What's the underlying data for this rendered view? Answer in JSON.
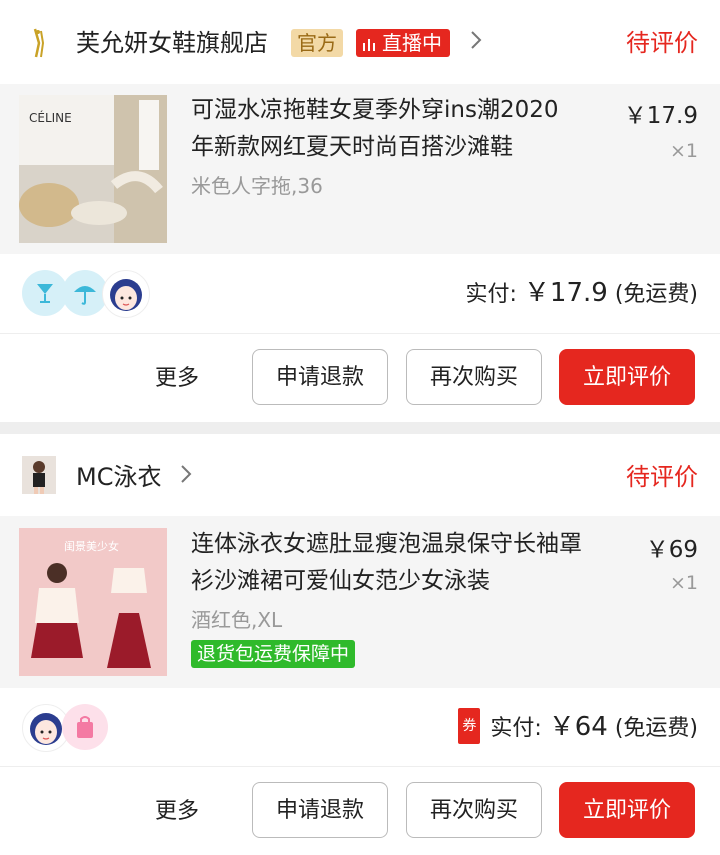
{
  "orders": [
    {
      "shop_name": "芙允妍女鞋旗舰店",
      "badge_official": "官方",
      "badge_live": "直播中",
      "status": "待评价",
      "product_name_line1": "可湿水凉拖鞋女夏季外穿ins潮2020",
      "product_name_line2": "年新款网红夏天时尚百搭沙滩鞋",
      "sku": "米色人字拖,36",
      "price": "￥17.9",
      "qty": "×1",
      "thumb_brand": "CÉLINE",
      "pay_label": "实付:",
      "pay_amount": "￥17.9",
      "pay_note": "(免运费)",
      "more": "更多",
      "btn_refund": "申请退款",
      "btn_rebuy": "再次购买",
      "btn_review": "立即评价"
    },
    {
      "shop_name": "MC泳衣",
      "status": "待评价",
      "product_name_line1": "连体泳衣女遮肚显瘦泡温泉保守长袖罩",
      "product_name_line2": "衫沙滩裙可爱仙女范少女泳装",
      "sku": "酒红色,XL",
      "guarantee": "退货包运费保障中",
      "price": "￥69",
      "qty": "×1",
      "thumb_caption": "闺景美少女",
      "coupon": "券",
      "pay_label": "实付:",
      "pay_amount": "￥64",
      "pay_note": "(免运费)",
      "more": "更多",
      "btn_refund": "申请退款",
      "btn_rebuy": "再次购买",
      "btn_review": "立即评价"
    }
  ],
  "colors": {
    "accent": "#e5271f",
    "guarantee": "#2fba2b",
    "official_bg": "#f3d9a6"
  },
  "icons": [
    "shop-logo-icon",
    "live-bars-icon",
    "chevron-right-icon",
    "cup-icon",
    "umbrella-icon",
    "avatar-girl-icon",
    "bag-icon"
  ]
}
